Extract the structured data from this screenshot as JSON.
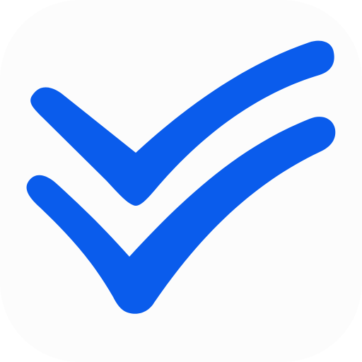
{
  "icon": {
    "name": "double-checkmark-icon",
    "background_color": "#fcfcfc",
    "mark_color": "#0a5cec"
  }
}
